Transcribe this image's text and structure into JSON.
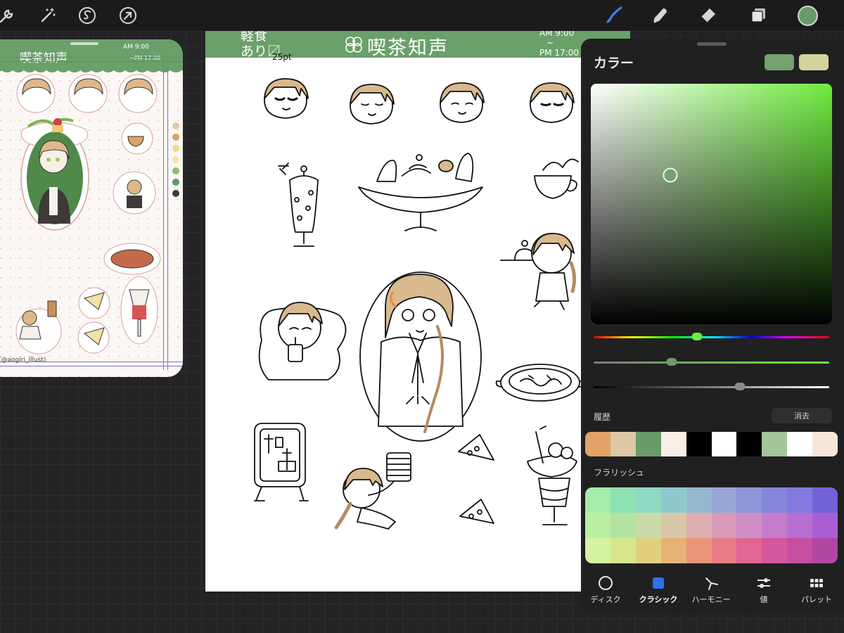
{
  "toolbar": {
    "left_tools": [
      "wrench-icon",
      "magic-wand-icon",
      "selection-icon",
      "transform-arrow-icon"
    ],
    "right_tools": [
      "brush-icon",
      "smudge-icon",
      "eraser-icon",
      "layers-icon"
    ],
    "current_color": "#6a9b6c"
  },
  "reference": {
    "title": "喫茶知声",
    "time_open": "AM 9:00",
    "time_close": "~PM 17:00",
    "footer": "(@aogiri_illust)",
    "header_color": "#6aa06a",
    "palette": [
      "#e3c8a6",
      "#d7a36a",
      "#f0d78c",
      "#efe3b6",
      "#8bbf6a",
      "#5f9a5e",
      "#3c3c3c"
    ]
  },
  "canvas": {
    "header_left": "軽食\nあり〼",
    "header_title": "喫茶知声",
    "header_right_line1": "AM 9:00",
    "header_right_line2": "~",
    "header_right_line3": "PM 17:00",
    "note": "25pt",
    "header_color": "#6aa06a"
  },
  "color_panel": {
    "title": "カラー",
    "primary_color": "#73a16f",
    "secondary_color": "#d4d3a0",
    "hue_color": "#6dec3d",
    "hue_position": 0.44,
    "saturation_position": 0.33,
    "brightness_position": 0.62,
    "sv_knob": {
      "saturation": 0.33,
      "brightness": 0.62
    },
    "history_label": "履歴",
    "clear_label": "消去",
    "history": [
      "#e2a266",
      "#dcc8a3",
      "#6a9b6a",
      "#f7efe6",
      "#000000",
      "#ffffff",
      "#000000",
      "#a2c59b",
      "#ffffff",
      "#f6e6d8"
    ],
    "flourish_label": "フラリッシュ",
    "flourish": [
      "#a6ecab",
      "#8de2b1",
      "#8fd8c4",
      "#8fc9cc",
      "#95b7cf",
      "#98a6d6",
      "#8e95d9",
      "#8585dc",
      "#8479e0",
      "#7262d8",
      "#b9eea3",
      "#b2e3a2",
      "#c9d9a8",
      "#d8c8a8",
      "#deaeb0",
      "#d99ab9",
      "#d08ec6",
      "#c57dcb",
      "#b56ed2",
      "#a95fd4",
      "#d4f2a0",
      "#d7e58c",
      "#e0cf7d",
      "#e7b374",
      "#e9957a",
      "#e87b84",
      "#e26694",
      "#d5579c",
      "#c64fa1",
      "#b146a3"
    ],
    "tabs": [
      {
        "label": "ディスク",
        "icon": "disc-icon"
      },
      {
        "label": "クラシック",
        "icon": "classic-square-icon"
      },
      {
        "label": "ハーモニー",
        "icon": "harmony-icon"
      },
      {
        "label": "値",
        "icon": "value-sliders-icon"
      },
      {
        "label": "パレット",
        "icon": "palette-grid-icon"
      }
    ],
    "active_tab": "クラシック"
  }
}
